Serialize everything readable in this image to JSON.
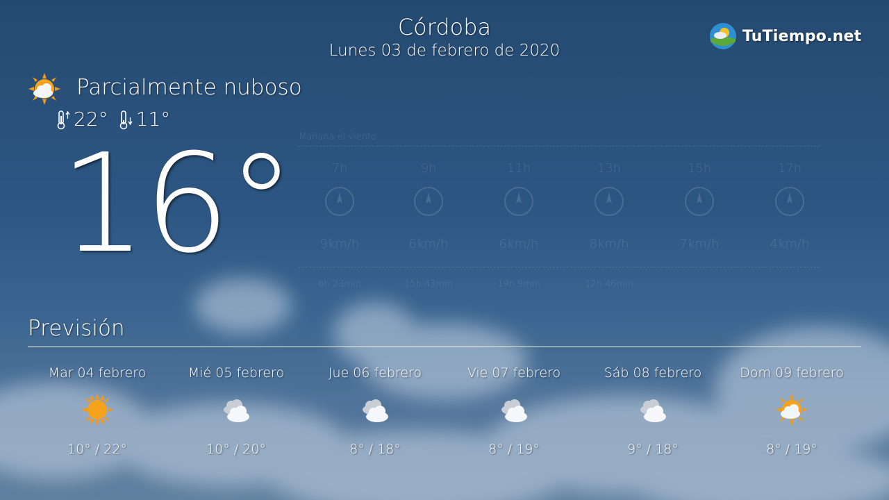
{
  "header": {
    "city": "Córdoba",
    "date": "Lunes 03 de febrero de 2020",
    "brand": "TuTiempo.net"
  },
  "current": {
    "condition": "Parcialmente nuboso",
    "condition_icon": "partly-cloudy-sun-icon",
    "max": "22°",
    "min": "11°",
    "temperature": "16°"
  },
  "wind": {
    "title": "Mañana el viento",
    "hours": [
      "7h",
      "9h",
      "11h",
      "13h",
      "15h",
      "17h"
    ],
    "speeds": [
      "9km/h",
      "6km/h",
      "6km/h",
      "8km/h",
      "7km/h",
      "4km/h"
    ],
    "sun": [
      "6h 23min",
      "15h 43min",
      "19h 9min",
      "12h 46min"
    ]
  },
  "forecast": {
    "title": "Previsión",
    "days": [
      {
        "name": "Mar 04 febrero",
        "icon": "sun-icon",
        "range": "10° / 22°"
      },
      {
        "name": "Mié 05 febrero",
        "icon": "clouds-icon",
        "range": "10° / 20°"
      },
      {
        "name": "Jue 06 febrero",
        "icon": "clouds-icon",
        "range": "8° / 18°"
      },
      {
        "name": "Vie 07 febrero",
        "icon": "clouds-icon",
        "range": "8° / 19°"
      },
      {
        "name": "Sáb 08 febrero",
        "icon": "clouds-icon",
        "range": "9° / 18°"
      },
      {
        "name": "Dom 09 febrero",
        "icon": "partly-cloudy-sun-icon",
        "range": "8° / 19°"
      }
    ]
  },
  "colors": {
    "sun": "#f39a18",
    "sky_top": "#254a71",
    "sky_bottom": "#5f809f"
  }
}
